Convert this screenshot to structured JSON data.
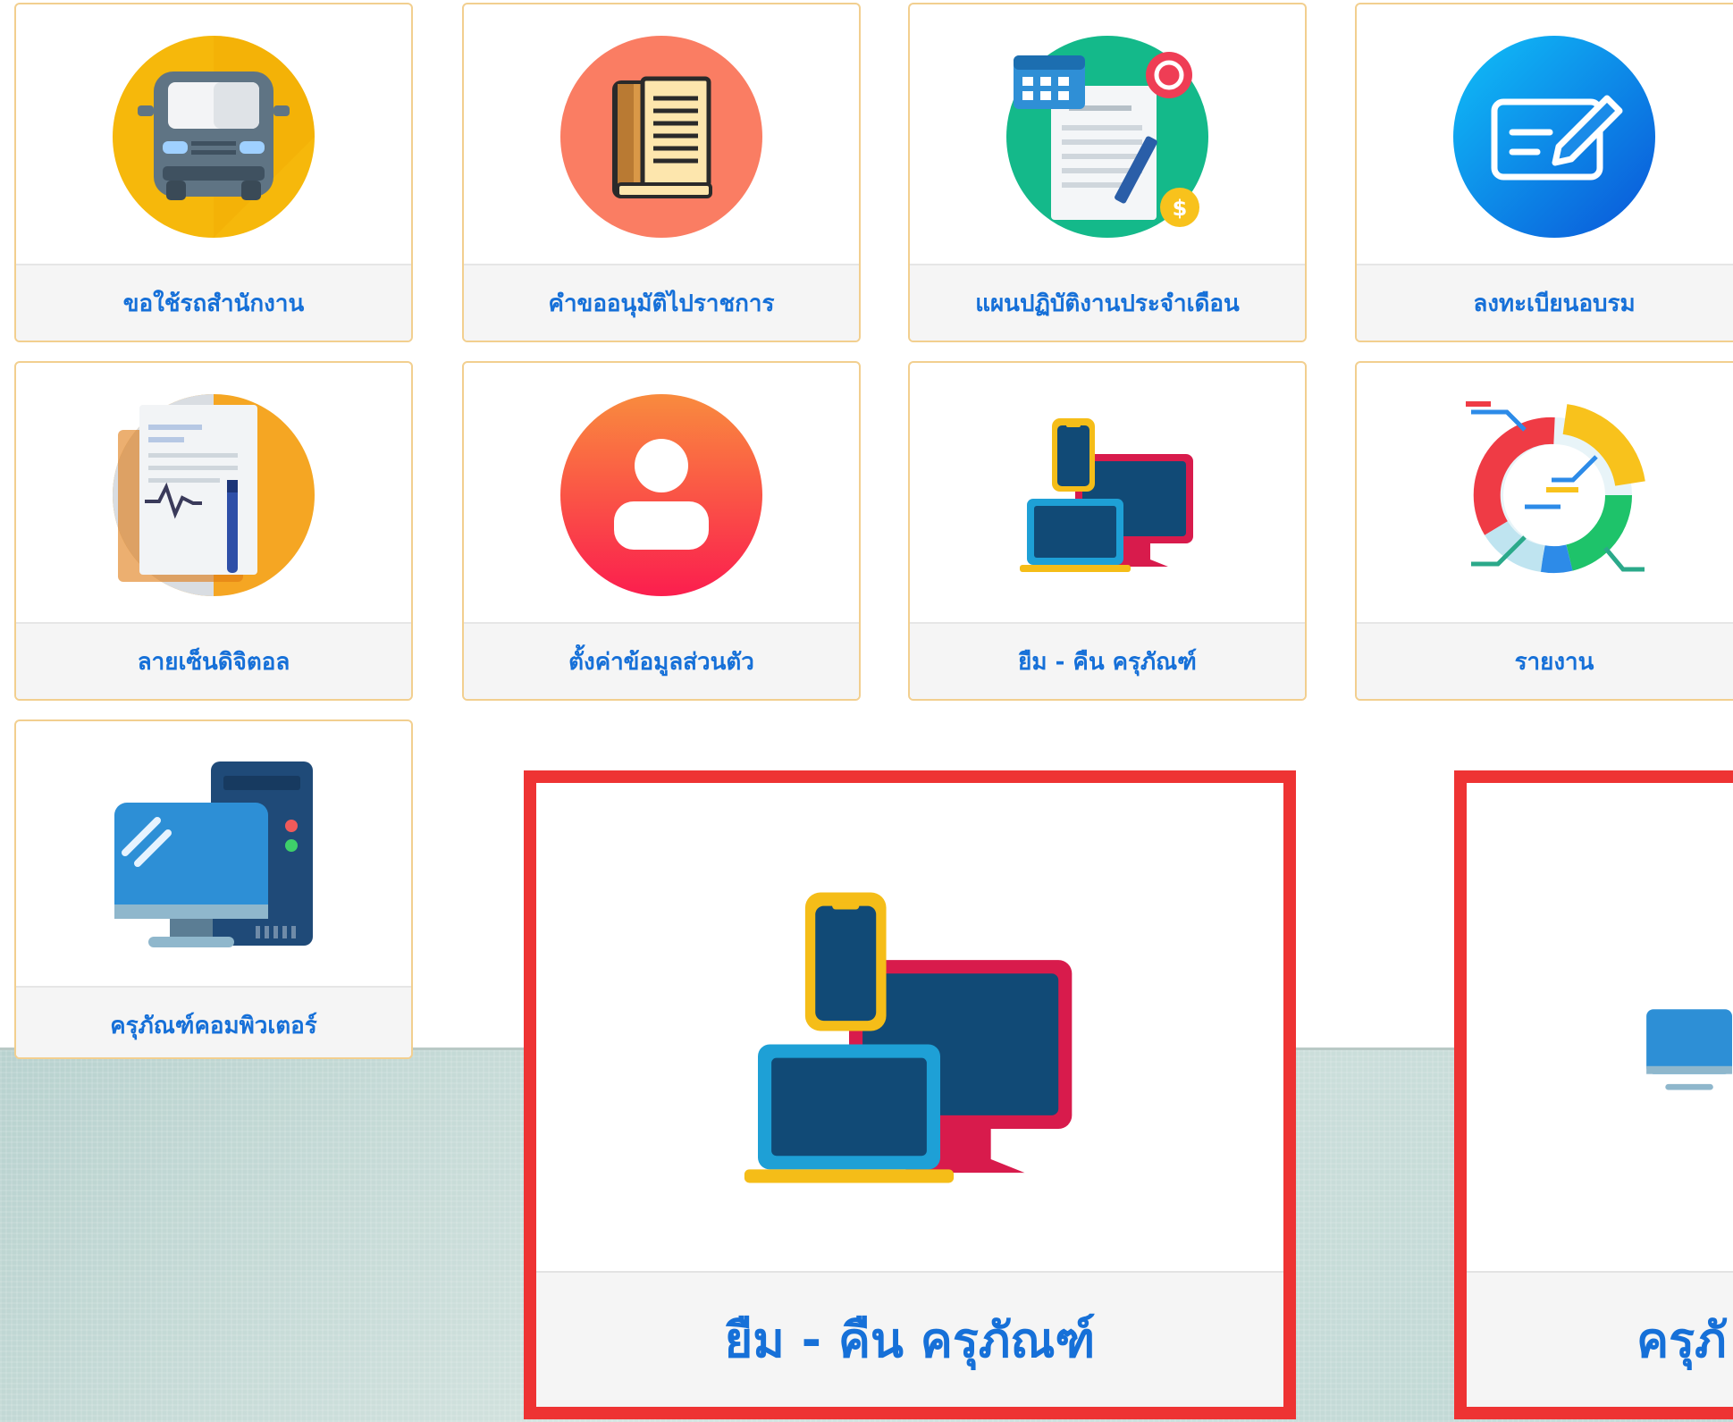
{
  "tiles": [
    {
      "label": "ขอใช้รถสำนักงาน",
      "icon": "van-icon"
    },
    {
      "label": "คำขออนุมัติไปราชการ",
      "icon": "book-icon"
    },
    {
      "label": "แผนปฏิบัติงานประจำเดือน",
      "icon": "plan-document-icon"
    },
    {
      "label": "ลงทะเบียนอบรม",
      "icon": "register-form-icon"
    },
    {
      "label": "ลายเซ็นดิจิตอล",
      "icon": "digital-signature-icon"
    },
    {
      "label": "ตั้งค่าข้อมูลส่วนตัว",
      "icon": "user-profile-icon"
    },
    {
      "label": "ยืม - คืน ครุภัณฑ์",
      "icon": "devices-icon"
    },
    {
      "label": "รายงาน",
      "icon": "report-chart-icon"
    },
    {
      "label": "ครุภัณฑ์คอมพิวเตอร์",
      "icon": "computer-icon"
    }
  ],
  "zoom_callouts": [
    {
      "label": "ยืม - คืน ครุภัณฑ์",
      "icon": "devices-icon"
    },
    {
      "label": "ครุภั",
      "icon": "computer-icon"
    }
  ],
  "colors": {
    "accent_text": "#1670d8",
    "tile_border": "#f2cf8f",
    "highlight": "#ee3333"
  }
}
